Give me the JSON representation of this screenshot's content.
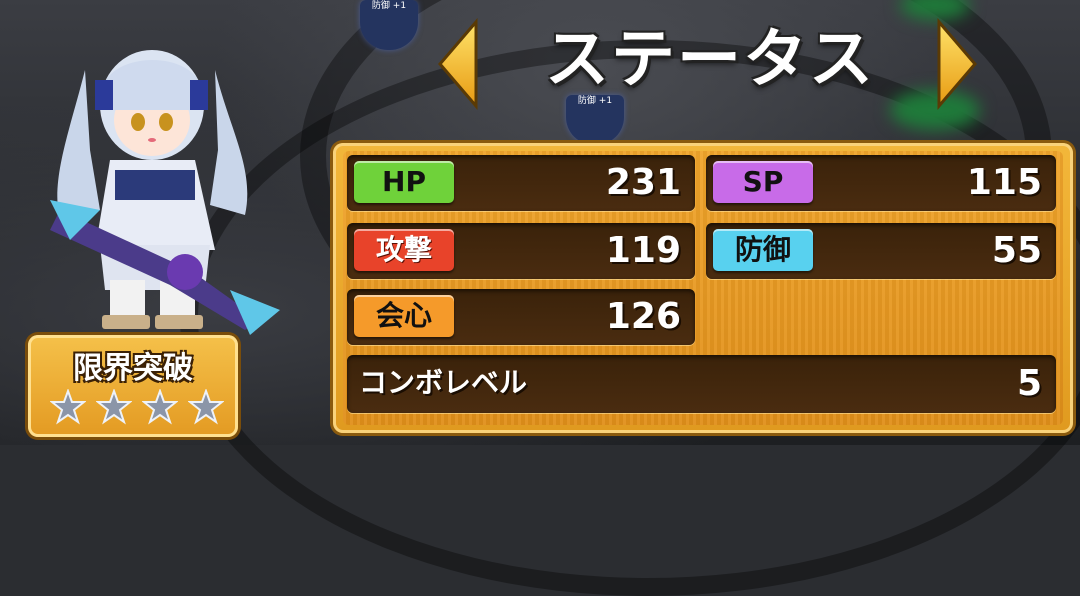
{
  "header": {
    "title": "ステータス"
  },
  "stats": {
    "hp": {
      "label": "HP",
      "value": "231",
      "color": "#6fd23a"
    },
    "sp": {
      "label": "SP",
      "value": "115",
      "color": "#c86be8"
    },
    "attack": {
      "label": "攻撃",
      "value": "119",
      "color": "#e8432a"
    },
    "defense": {
      "label": "防御",
      "value": "55",
      "color": "#58d1ef"
    },
    "critical": {
      "label": "会心",
      "value": "126",
      "color": "#f59a2a"
    },
    "combo": {
      "label": "コンボレベル",
      "value": "5"
    }
  },
  "limit_break": {
    "title": "限界突破",
    "stars_filled": 0,
    "stars_total": 4
  },
  "background_labels": {
    "top": "防御 +1",
    "middle": "防御 +1"
  },
  "icons": {
    "prev": "left-triangle-arrow",
    "next": "right-triangle-arrow",
    "star": "empty-star"
  }
}
